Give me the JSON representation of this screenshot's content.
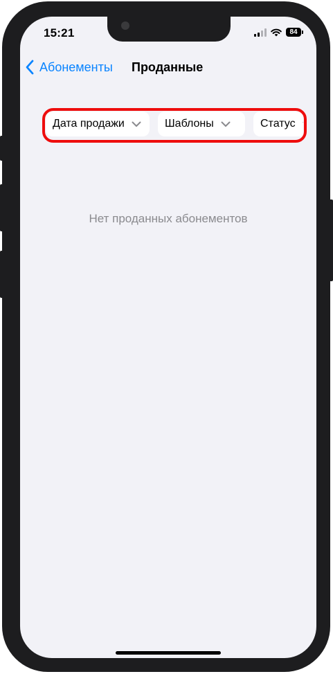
{
  "status_bar": {
    "time": "15:21",
    "battery": "84"
  },
  "nav": {
    "back_label": "Абонементы",
    "title": "Проданные"
  },
  "filters": [
    {
      "label": "Дата продажи"
    },
    {
      "label": "Шаблоны"
    },
    {
      "label": "Статус"
    }
  ],
  "empty_state": {
    "text": "Нет проданных абонементов"
  },
  "colors": {
    "accent": "#0a84ff",
    "highlight": "#ee0d0d",
    "background": "#f2f2f7"
  }
}
